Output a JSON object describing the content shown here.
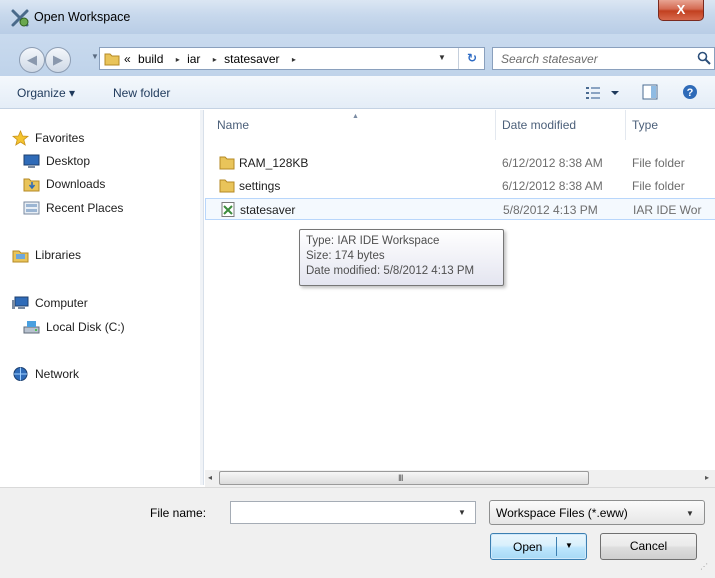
{
  "window": {
    "title": "Open Workspace",
    "close_label": "X"
  },
  "nav": {
    "back_icon": "back-arrow-icon",
    "forward_icon": "forward-arrow-icon"
  },
  "address": {
    "overflow": "«",
    "crumbs": [
      "build",
      "iar",
      "statesaver"
    ],
    "separator": "▸"
  },
  "search": {
    "placeholder": "Search statesaver"
  },
  "toolbar": {
    "organize_label": "Organize ▾",
    "new_folder_label": "New folder"
  },
  "sidebar": {
    "items": [
      {
        "label": "Favorites",
        "icon": "star-icon"
      },
      {
        "label": "Desktop",
        "icon": "desktop-icon"
      },
      {
        "label": "Downloads",
        "icon": "downloads-folder-icon"
      },
      {
        "label": "Recent Places",
        "icon": "recent-places-icon"
      },
      {
        "label": "Libraries",
        "icon": "libraries-icon"
      },
      {
        "label": "Computer",
        "icon": "computer-icon"
      },
      {
        "label": "Local Disk (C:)",
        "icon": "local-disk-icon"
      },
      {
        "label": "Network",
        "icon": "network-icon"
      }
    ]
  },
  "columns": {
    "name": "Name",
    "date": "Date modified",
    "type": "Type"
  },
  "files": [
    {
      "name": "RAM_128KB",
      "date": "6/12/2012 8:38 AM",
      "type": "File folder",
      "icon": "folder-icon"
    },
    {
      "name": "settings",
      "date": "6/12/2012 8:38 AM",
      "type": "File folder",
      "icon": "folder-icon"
    },
    {
      "name": "statesaver",
      "date": "5/8/2012 4:13 PM",
      "type": "IAR IDE Wor",
      "icon": "workspace-file-icon"
    }
  ],
  "tooltip": {
    "line1": "Type: IAR IDE Workspace",
    "line2": "Size: 174 bytes",
    "line3": "Date modified: 5/8/2012 4:13 PM"
  },
  "scrollbar": {
    "left_arrow": "◂",
    "right_arrow": "▸",
    "grip": "III"
  },
  "bottom": {
    "file_name_label": "File name:",
    "file_name_value": "",
    "filter_value": "Workspace Files (*.eww)",
    "open_label": "Open",
    "cancel_label": "Cancel"
  }
}
